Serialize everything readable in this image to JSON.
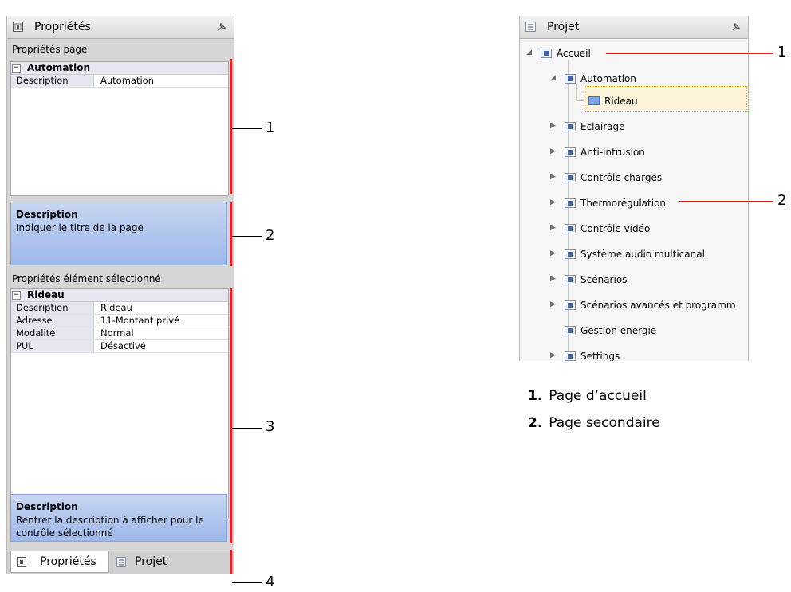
{
  "properties_panel": {
    "title": "Propriétés",
    "page_section_label": "Propriétés page",
    "page_group": {
      "header": "Automation",
      "rows": [
        {
          "key": "Description",
          "value": "Automation"
        }
      ]
    },
    "page_description": {
      "title": "Description",
      "text": "Indiquer le titre de la page"
    },
    "element_section_label": "Propriétés élément sélectionné",
    "element_group": {
      "header": "Rideau",
      "rows": [
        {
          "key": "Description",
          "value": "Rideau"
        },
        {
          "key": "Adresse",
          "value": "11-Montant privé"
        },
        {
          "key": "Modalité",
          "value": "Normal"
        },
        {
          "key": "PUL",
          "value": "Désactivé"
        }
      ]
    },
    "element_description": {
      "title": "Description",
      "line1": "Rentrer la description à afficher pour le",
      "line2": "contrôle sélectionné"
    },
    "tabs": [
      {
        "label": "Propriétés",
        "icon": "properties-icon",
        "active": true
      },
      {
        "label": "Projet",
        "icon": "project-icon",
        "active": false
      }
    ]
  },
  "callouts_left": [
    "1",
    "2",
    "3",
    "4"
  ],
  "project_panel": {
    "title": "Projet",
    "tree": [
      {
        "label": "Accueil",
        "level": 0,
        "expanded": true
      },
      {
        "label": "Automation",
        "level": 1,
        "expanded": true
      },
      {
        "label": "Rideau",
        "level": 2,
        "selected": true
      },
      {
        "label": "Eclairage",
        "level": 1
      },
      {
        "label": "Anti-intrusion",
        "level": 1
      },
      {
        "label": "Contrôle charges",
        "level": 1
      },
      {
        "label": "Thermorégulation",
        "level": 1
      },
      {
        "label": "Contrôle vidéo",
        "level": 1
      },
      {
        "label": "Système audio multicanal",
        "level": 1
      },
      {
        "label": "Scénarios",
        "level": 1
      },
      {
        "label": "Scénarios avancés et programm",
        "level": 1
      },
      {
        "label": "Gestion énergie",
        "level": 1
      },
      {
        "label": "Settings",
        "level": 1
      }
    ]
  },
  "callouts_right": [
    "1",
    "2"
  ],
  "legend": [
    {
      "num": "1.",
      "text": "Page d’accueil"
    },
    {
      "num": "2.",
      "text": "Page secondaire"
    }
  ],
  "colors": {
    "callout_red": "#e02020",
    "description_blue": "#9db8ea",
    "selection_yellow": "#fdf3d8"
  }
}
